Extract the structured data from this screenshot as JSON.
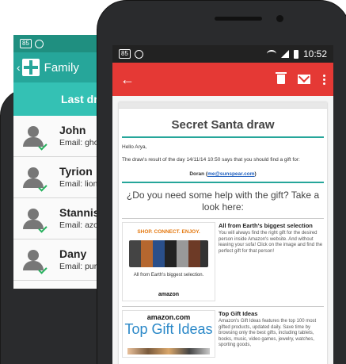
{
  "back_app": {
    "status_badge": "85",
    "title": "Family",
    "header": "Last draw",
    "people": [
      {
        "name": "John",
        "email": "Email: gho..."
      },
      {
        "name": "Tyrion",
        "email": "Email: lion..."
      },
      {
        "name": "Stannis",
        "email": "Email: azo..."
      },
      {
        "name": "Dany",
        "email": "Email: pur..."
      }
    ]
  },
  "front_app": {
    "status_badge": "85",
    "time": "10:52",
    "email": {
      "title": "Secret Santa draw",
      "greeting": "Hello Arya,",
      "message": "The draw's result of the day 14/11/14 10:50 says that you should find a gift for:",
      "recipient_name": "Doran (",
      "recipient_email": "me@sunspear.com",
      "recipient_close": ")",
      "question": "¿Do you need some help with the gift? Take a look here:",
      "promos": [
        {
          "image_slogan": "SHOP. CONNECT. ENJOY.",
          "image_caption": "All from Earth's biggest selection.",
          "image_brand": "amazon",
          "title": "All from Earth's biggest selection",
          "description": "You will always find the right gift for the desired person inside Amazon's website. And without leaving your sofa! Click on the image and find the perfect gift for that person!"
        },
        {
          "image_brand": "amazon.com",
          "image_heading": "Top Gift Ideas",
          "title": "Top Gift Ideas",
          "description": "Amazon's Gift Ideas features the top 100 most gifted products, updated daily. Save time by browsing only the best gifts, including tablets, books, music, video games, jewelry, watches, sporting goods,"
        }
      ]
    }
  }
}
